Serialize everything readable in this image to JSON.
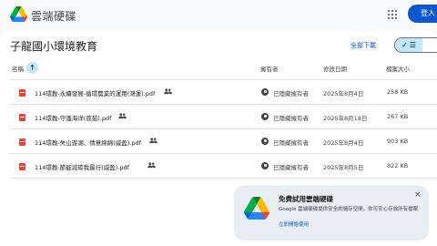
{
  "header": {
    "app_title": "雲端硬碟",
    "sign_in": "登入",
    "apps_icon": "apps-grid-icon"
  },
  "folder": {
    "title": "子龍國小環境教育",
    "download_all": "全部下載",
    "view_icon": "check-list-icon"
  },
  "table": {
    "columns": {
      "name": "名稱",
      "owner": "擁有者",
      "modified": "修改日期",
      "size": "檔案大小"
    },
    "sort_icon": "arrow-up-icon",
    "rows": [
      {
        "name": "114環教-永續發展-循環農業的運用(鴻運).pdf",
        "owner": "已隱藏擁有者",
        "modified": "2025年8月4日",
        "size": "258 KB"
      },
      {
        "name": "114環教-守護海洋(荔茹).pdf",
        "owner": "已隱藏擁有者",
        "modified": "2025年8月18日",
        "size": "267 KB"
      },
      {
        "name": "114環教-失山遊湖、情意綿綿(威盈).pdf",
        "owner": "已隱藏擁有者",
        "modified": "2025年8月4日",
        "size": "903 KB"
      },
      {
        "name": "114環教-節能減碳我最行(威盈).pdf",
        "owner": "已隱藏擁有者",
        "modified": "2025年8月5日",
        "size": "822 KB"
      }
    ]
  },
  "promo": {
    "title": "免費試用雲端硬碟",
    "body": "Google 雲端硬碟提供安全的儲存空間，你可安心存放所有檔案",
    "link": "立即開始使用",
    "close": "×"
  },
  "colors": {
    "accent": "#0b57d0",
    "selected": "#c2e7ff",
    "pdf": "#ea4335",
    "background": "#f8fafd"
  }
}
